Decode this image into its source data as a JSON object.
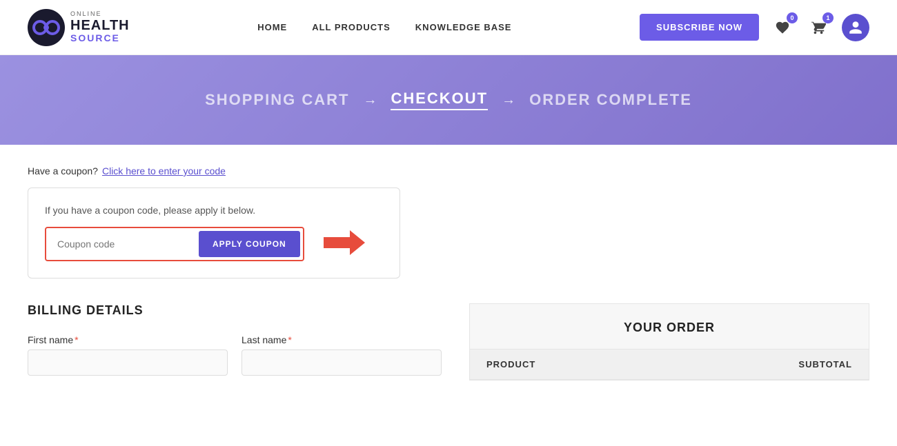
{
  "header": {
    "logo": {
      "online_label": "ONLINE",
      "health_label": "HEALTH",
      "source_label": "SOURCE"
    },
    "nav": {
      "items": [
        {
          "label": "HOME",
          "id": "home"
        },
        {
          "label": "ALL PRODUCTS",
          "id": "all-products"
        },
        {
          "label": "KNOWLEDGE BASE",
          "id": "knowledge-base"
        }
      ]
    },
    "subscribe_label": "SUBSCRIBE NOW",
    "wishlist_badge": "0",
    "cart_badge": "1"
  },
  "breadcrumb": {
    "items": [
      {
        "label": "SHOPPING CART",
        "active": false
      },
      {
        "label": "CHECKOUT",
        "active": true
      },
      {
        "label": "ORDER COMPLETE",
        "active": false
      }
    ]
  },
  "coupon_section": {
    "notice_text": "Have a coupon?",
    "link_text": "Click here to enter your code",
    "instruction": "If you have a coupon code, please apply it below.",
    "input_placeholder": "Coupon code",
    "apply_button_label": "APPLY COUPON"
  },
  "billing": {
    "title": "BILLING DETAILS",
    "first_name_label": "First name",
    "last_name_label": "Last name",
    "required_marker": "*"
  },
  "order_summary": {
    "title": "YOUR ORDER",
    "product_col": "PRODUCT",
    "subtotal_col": "SUBTOTAL"
  }
}
